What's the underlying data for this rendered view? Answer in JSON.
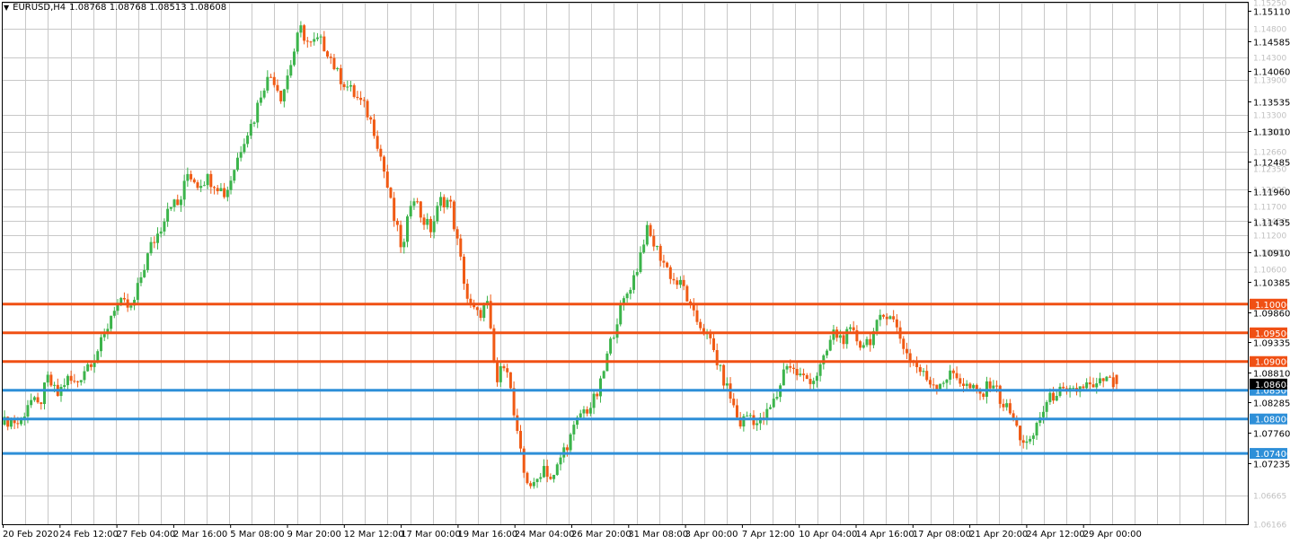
{
  "header": {
    "symbol": "EURUSD,H4",
    "ohlc": "1.08768 1.08768 1.08513 1.08608"
  },
  "colors": {
    "background": "#ffffff",
    "grid": "#c8c8c8",
    "frame": "#000000",
    "bull_candle": "#3cb44b",
    "bear_candle": "#f05a14",
    "resistance_line": "#f05014",
    "support_line": "#2e8fd8",
    "current_price_bg": "#000000",
    "faint_label": "#c0c0c0"
  },
  "chart_data": {
    "type": "candlestick",
    "title": "EURUSD,H4",
    "symbol": "EURUSD",
    "timeframe": "H4",
    "ylim": [
      1.06166,
      1.1525
    ],
    "grid": true,
    "y_tick_labels": [
      "1.15110",
      "1.14585",
      "1.14060",
      "1.13535",
      "1.13010",
      "1.12485",
      "1.11960",
      "1.11435",
      "1.10910",
      "1.10385",
      "1.09860",
      "1.09335",
      "1.08810",
      "1.08285",
      "1.07760",
      "1.07235"
    ],
    "y_faint_labels": [
      "1.15250",
      "1.14800",
      "1.14300",
      "1.13900",
      "1.13300",
      "1.13000",
      "1.12660",
      "1.12350",
      "1.12000",
      "1.11700",
      "1.11450",
      "1.11200",
      "1.10900",
      "1.10600",
      "1.06665",
      "1.06166"
    ],
    "current_price": "1.08608",
    "x_tick_labels": [
      "20 Feb 2020",
      "24 Feb 12:00",
      "27 Feb 04:00",
      "2 Mar 16:00",
      "5 Mar 08:00",
      "9 Mar 20:00",
      "12 Mar 12:00",
      "17 Mar 00:00",
      "19 Mar 16:00",
      "24 Mar 04:00",
      "26 Mar 20:00",
      "31 Mar 08:00",
      "3 Apr 00:00",
      "7 Apr 12:00",
      "10 Apr 04:00",
      "14 Apr 16:00",
      "17 Apr 08:00",
      "21 Apr 20:00",
      "24 Apr 12:00",
      "29 Apr 00:00"
    ],
    "horizontal_levels": [
      {
        "price": 1.1,
        "label": "1.10000",
        "kind": "resistance"
      },
      {
        "price": 1.095,
        "label": "1.09500",
        "kind": "resistance"
      },
      {
        "price": 1.09,
        "label": "1.09000",
        "kind": "resistance"
      },
      {
        "price": 1.085,
        "label": "1.08500",
        "kind": "support"
      },
      {
        "price": 1.08,
        "label": "1.08000",
        "kind": "support"
      },
      {
        "price": 1.074,
        "label": "1.07400",
        "kind": "support"
      }
    ],
    "price_path": [
      1.079,
      1.08,
      1.079,
      1.0835,
      1.082,
      1.087,
      1.084,
      1.087,
      1.086,
      1.089,
      1.091,
      1.094,
      1.0995,
      1.1,
      1.099,
      1.105,
      1.11,
      1.113,
      1.118,
      1.117,
      1.123,
      1.121,
      1.122,
      1.121,
      1.119,
      1.124,
      1.129,
      1.132,
      1.138,
      1.14,
      1.136,
      1.142,
      1.148,
      1.145,
      1.146,
      1.144,
      1.14,
      1.138,
      1.136,
      1.134,
      1.13,
      1.123,
      1.115,
      1.109,
      1.12,
      1.115,
      1.113,
      1.118,
      1.118,
      1.109,
      1.1,
      1.098,
      1.1,
      1.086,
      1.091,
      1.079,
      1.07,
      1.068,
      1.072,
      1.069,
      1.074,
      1.077,
      1.081,
      1.082,
      1.085,
      1.092,
      1.098,
      1.102,
      1.106,
      1.113,
      1.11,
      1.107,
      1.104,
      1.103,
      1.098,
      1.096,
      1.093,
      1.088,
      1.084,
      1.079,
      1.081,
      1.079,
      1.081,
      1.084,
      1.09,
      1.088,
      1.087,
      1.087,
      1.09,
      1.095,
      1.094,
      1.095,
      1.093,
      1.094,
      1.097,
      1.099,
      1.095,
      1.091,
      1.089,
      1.087,
      1.086,
      1.087,
      1.088,
      1.086,
      1.085,
      1.084,
      1.087,
      1.083,
      1.081,
      1.077,
      1.075,
      1.08,
      1.083,
      1.085,
      1.084,
      1.085,
      1.086,
      1.085,
      1.087,
      1.086
    ],
    "ohlc_last": {
      "open": 1.08768,
      "high": 1.08768,
      "low": 1.08513,
      "close": 1.08608
    }
  }
}
